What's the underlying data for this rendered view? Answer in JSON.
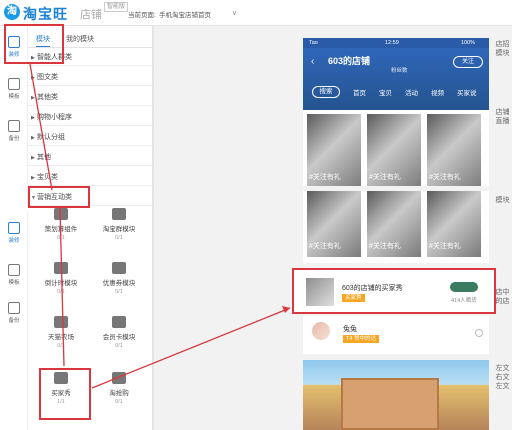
{
  "topbar": {
    "logo_mark": "淘",
    "logo_text": "淘宝旺铺",
    "section": "店铺",
    "badge": "智能版",
    "current_page_label": "当前页面:",
    "current_page": "手机淘宝店铺首页",
    "dropdown_arrow": "∨"
  },
  "rail_top": [
    {
      "label": "装修",
      "icon": "brush-icon"
    },
    {
      "label": "模板",
      "icon": "template-icon"
    },
    {
      "label": "备份",
      "icon": "backup-icon"
    }
  ],
  "rail_bottom": [
    {
      "label": "装修",
      "icon": "brush-icon"
    },
    {
      "label": "模板",
      "icon": "template-icon"
    },
    {
      "label": "备份",
      "icon": "backup-icon"
    }
  ],
  "module_tabs": [
    "模块",
    "我的模块"
  ],
  "categories": [
    "智能人群类",
    "图文类",
    "其他类",
    "购物小程序",
    "默认分组",
    "其他",
    "宝贝类",
    "营销互动类"
  ],
  "modules": [
    {
      "name": "策划算组件",
      "count": "0/1",
      "icon": "plan-icon"
    },
    {
      "name": "淘宝群模块",
      "count": "0/1",
      "icon": "group-icon"
    },
    {
      "name": "倒计时模块",
      "count": "0/1",
      "icon": "countdown-icon"
    },
    {
      "name": "优惠券模块",
      "count": "0/1",
      "icon": "coupon-icon"
    },
    {
      "name": "天猫农场",
      "count": "0/1",
      "icon": "farm-icon"
    },
    {
      "name": "会员卡模块",
      "count": "0/1",
      "icon": "vip-card-icon"
    },
    {
      "name": "买家秀",
      "count": "1/1",
      "icon": "buyer-show-icon"
    },
    {
      "name": "淘抢购",
      "count": "0/1",
      "icon": "flash-sale-icon"
    }
  ],
  "phone": {
    "carrier": "Tao",
    "time": "12:59",
    "battery": "100%",
    "shop_name": "603的店铺",
    "fans": "粉丝数",
    "follow": "关注",
    "search": "搜索",
    "nav": [
      "首页",
      "宝贝",
      "活动",
      "视频",
      "买家说"
    ],
    "tile_label": "#关注有礼",
    "card_title": "603的店铺的买家秀",
    "card_tag": "买家秀",
    "card_count": "414人晒货",
    "user_name": "兔兔",
    "user_tag": "T4 赞中的达"
  },
  "side_tabs": [
    "店招模块",
    "店铺直播",
    "模块",
    "店中的店",
    "左文右文左文"
  ]
}
